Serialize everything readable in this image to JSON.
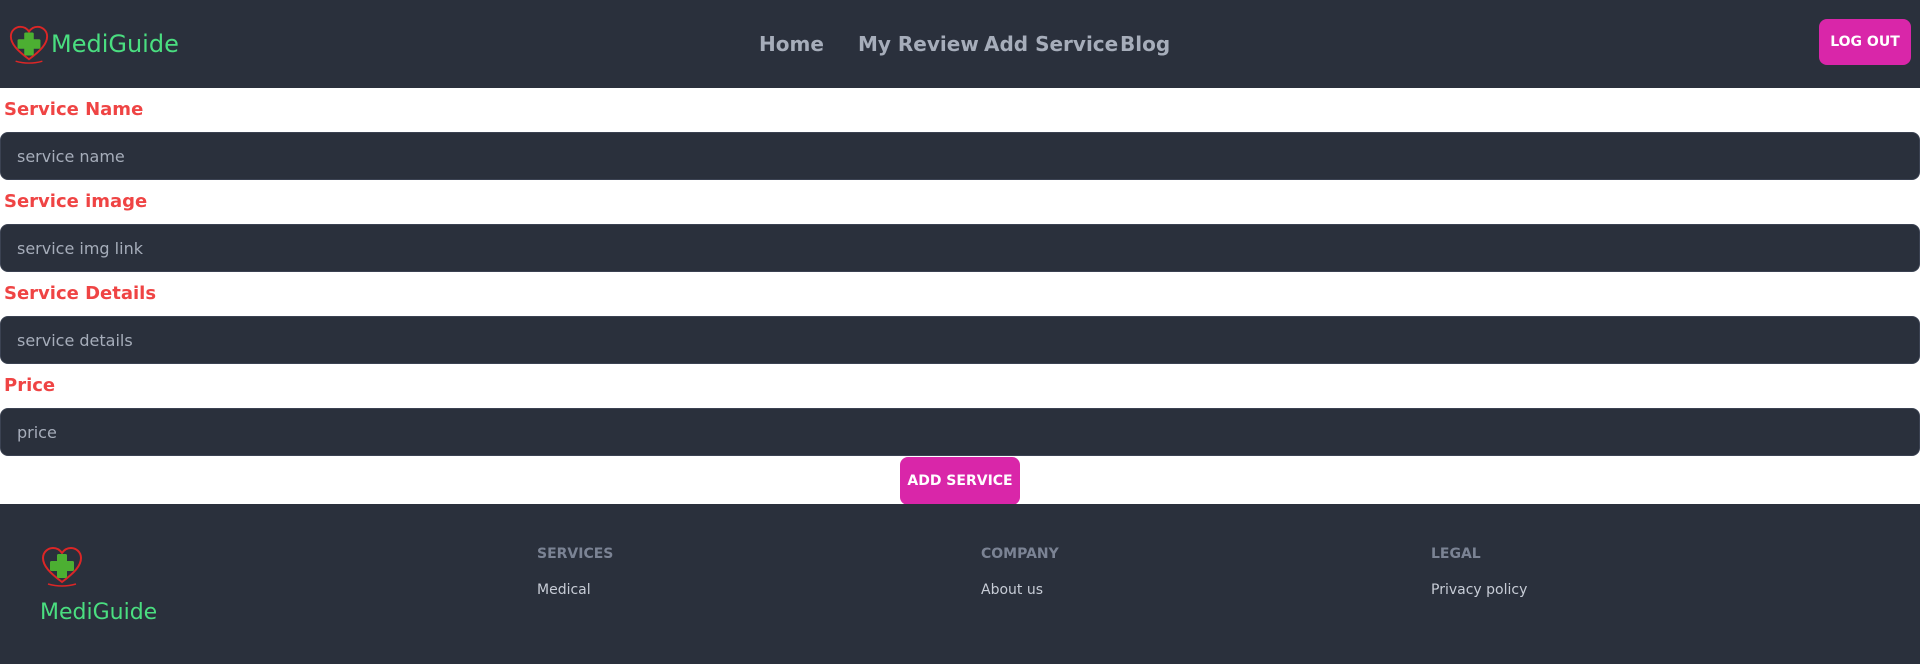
{
  "header": {
    "brand": "MediGuide",
    "nav": [
      "Home",
      "My Review",
      "Add Service",
      "Blog"
    ],
    "logout_label": "LOG OUT"
  },
  "form": {
    "fields": [
      {
        "label": "Service Name",
        "placeholder": "service name"
      },
      {
        "label": "Service image",
        "placeholder": "service img link"
      },
      {
        "label": "Service Details",
        "placeholder": "service details"
      },
      {
        "label": "Price",
        "placeholder": "price"
      }
    ],
    "submit_label": "ADD SERVICE"
  },
  "footer": {
    "brand": "MediGuide",
    "columns": [
      {
        "title": "SERVICES",
        "links": [
          "Medical"
        ]
      },
      {
        "title": "COMPANY",
        "links": [
          "About us"
        ]
      },
      {
        "title": "LEGAL",
        "links": [
          "Privacy policy"
        ]
      }
    ]
  },
  "colors": {
    "navbar_bg": "#2a303c",
    "brand_green": "#4ade80",
    "accent_pink": "#d926a9",
    "label_red": "#ef4444"
  },
  "icons": {
    "logo": "heart-medical-cross-icon"
  }
}
